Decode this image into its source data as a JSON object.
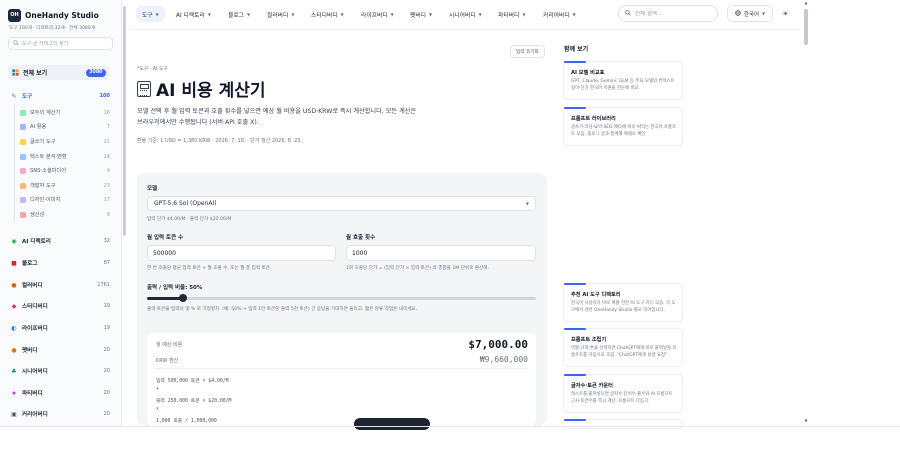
{
  "brand": {
    "logo": "OH",
    "name": "OneHandy Studio"
  },
  "stats": "도구 100개 · 디렉토리 32개 · 전체 3080개",
  "sidebar_search": {
    "placeholder": "도구·글·카테고리 찾기"
  },
  "all": {
    "label": "전체 보기",
    "count": "3080"
  },
  "categories": [
    {
      "label": "도구",
      "count": "100",
      "icon": "wrench-icon",
      "color": "#3b63f3"
    },
    {
      "label": "AI 디렉토리",
      "count": "32",
      "icon": "robot-icon",
      "color": "#16a34a"
    },
    {
      "label": "블로그",
      "count": "87",
      "icon": "book-icon",
      "color": "#dc2626"
    },
    {
      "label": "컬러버디",
      "count": "2761",
      "icon": "palette-icon",
      "color": "#ea580c"
    },
    {
      "label": "스터디버디",
      "count": "19",
      "icon": "study-icon",
      "color": "#db2777"
    },
    {
      "label": "라이프버디",
      "count": "19",
      "icon": "life-icon",
      "color": "#2563eb"
    },
    {
      "label": "펫버디",
      "count": "20",
      "icon": "pet-icon",
      "color": "#d97706"
    },
    {
      "label": "시니어버디",
      "count": "20",
      "icon": "senior-icon",
      "color": "#059669"
    },
    {
      "label": "파티버디",
      "count": "20",
      "icon": "party-icon",
      "color": "#c026d3"
    },
    {
      "label": "커리어버디",
      "count": "20",
      "icon": "briefcase-icon",
      "color": "#475569"
    }
  ],
  "subcategories": [
    {
      "label": "모두의 계산기",
      "count": "16",
      "color": "#86efac"
    },
    {
      "label": "AI 활용",
      "count": "7",
      "color": "#a5b4fc"
    },
    {
      "label": "글쓰기 도구",
      "count": "11",
      "color": "#fcd34d"
    },
    {
      "label": "텍스트 분석·변환",
      "count": "14",
      "color": "#93c5fd"
    },
    {
      "label": "SNS·소셜미디어",
      "count": "4",
      "color": "#f9a8d4"
    },
    {
      "label": "개발자 도구",
      "count": "23",
      "color": "#fdba74"
    },
    {
      "label": "디자인·이미지",
      "count": "17",
      "color": "#c4b5fd"
    },
    {
      "label": "생산성",
      "count": "8",
      "color": "#fca5a5"
    }
  ],
  "nav": [
    {
      "label": "도구"
    },
    {
      "label": "AI 디렉토리"
    },
    {
      "label": "블로그"
    },
    {
      "label": "컬러버디"
    },
    {
      "label": "스터디버디"
    },
    {
      "label": "라이프버디"
    },
    {
      "label": "펫버디"
    },
    {
      "label": "시니어버디"
    },
    {
      "label": "파티버디"
    },
    {
      "label": "커리어버디"
    }
  ],
  "top_search": {
    "placeholder": "전체 검색..."
  },
  "language": "한국어",
  "main": {
    "reset": "입력 초기화",
    "breadcrumb": "*도구 · AI 도구",
    "title": "AI 비용 계산기",
    "description": "모델 선택 후 월 입력 토큰과 호출 횟수를 넣으면 예상 월 비용을 USD·KRW로 즉시 계산합니다. 모든 계산은 브라우저에서만 수행됩니다 (서버·API 호출 X).",
    "rate": "환율 기준: 1 USD = 1,380 KRW · 2026. 7. 18. · 단가 갱신 2026. 8. 23."
  },
  "form": {
    "model_label": "모델",
    "model_value": "GPT-5.6 Sol (OpenAI)",
    "model_hint": "입력 단가 $4.00/M · 출력 단가 $20.00/M",
    "tokens_label": "월 입력 토큰 수",
    "tokens_value": "500000",
    "tokens_hint": "한 번 호출당 평균 입력 토큰 × 월 호출 수, 또는 월 총 입력 토큰.",
    "calls_label": "월 호출 횟수",
    "calls_value": "1000",
    "calls_hint": "1회 호출당 단가 = (입력 단가 × 입력 토큰) 의 총합을 1M 단위로 환산해.",
    "ratio_label": "출력 / 입력 비율: 50%",
    "ratio_value": 0.5,
    "ratio_hint": "출력 토큰을 입력의 몇 % 로 가정할지. (예: 50% → 입력 1만 토큰당 출력 5천 토큰) 긴 응답을 기대하면 올리고, 짧은 분류 작업은 내리세요."
  },
  "result": {
    "monthly_label": "월 예상 비용",
    "usd": "$7,000.00",
    "krw_label": "KRW 환산",
    "krw": "₩9,660,000",
    "line1": "입력 500,000 토큰 × $4.00/M",
    "line2": "+",
    "line3": "출력 250,000 토큰 × $20.00/M",
    "line4": "×",
    "line5": "1,000 호출 / 1,000,000"
  },
  "right_panel": {
    "title": "함께 보기",
    "cards_top": [
      {
        "title": "AI 모델 비교표",
        "desc": "GPT, Claude, Gemini, GLM 등 주요 모델의 컨텍스트 길이·단가 한국어 지원을 한눈에 비교."
      },
      {
        "title": "프롬프트 라이브러리",
        "desc": "글쓰기·코딩·요약·SEO 메타에 바로 써먹는 한국어 프롬프트 모음. 블로그 글과 연계해 예제로 확인."
      }
    ],
    "cards_bottom": [
      {
        "title": "추천 AI 도구 디렉토리",
        "desc": "한국어 사용자가 바로 써볼 만한 AI 도구 카드 모음. 각 도구에서 관련 OneHandy Studio 툴로 이어집니다."
      },
      {
        "title": "프롬프트 조립기",
        "desc": "역할·규칙·톤을 선택하면 ChatGPT에게 바로 붙여넣을 프롬프트를 자동으로 조립. \"ChatGPT에게 보낼 요청\"."
      },
      {
        "title": "글자수·토큰 카운터",
        "desc": "텍스트를 붙여넣으면 글자수·단어수·줄수와 AI 프롬프트 근사 토큰수를 즉시 계산. 프롬프트 다듬기."
      }
    ]
  }
}
